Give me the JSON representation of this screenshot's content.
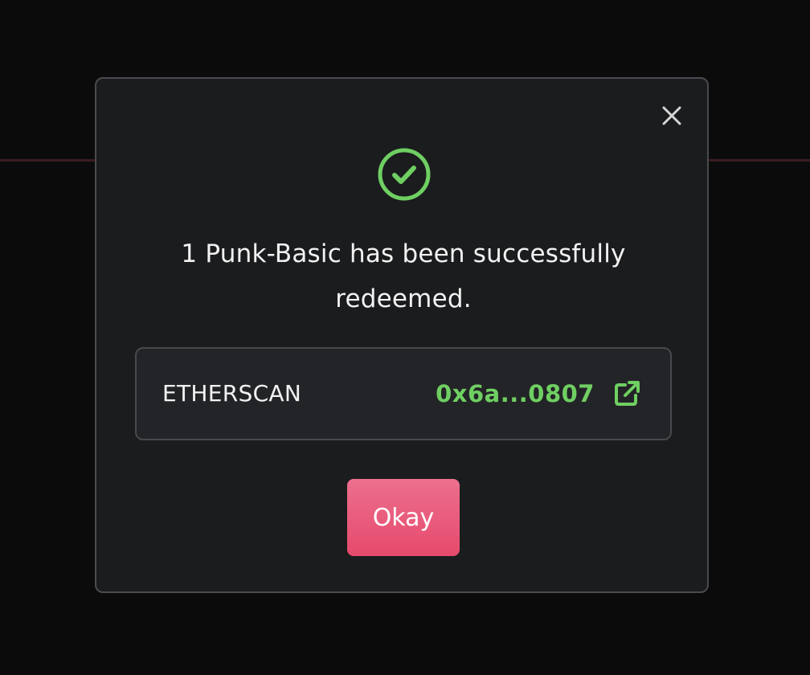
{
  "modal": {
    "message": "1 Punk-Basic has been successfully redeemed.",
    "etherscan": {
      "label": "ETHERSCAN",
      "tx_hash": "0x6a...0807"
    },
    "okay_label": "Okay"
  },
  "icons": {
    "close": "close-icon",
    "success": "check-circle-icon",
    "external_link": "external-link-icon"
  },
  "colors": {
    "success_green": "#6fcf62",
    "button_pink": "#e95a7b",
    "modal_bg": "#1b1c1e"
  }
}
